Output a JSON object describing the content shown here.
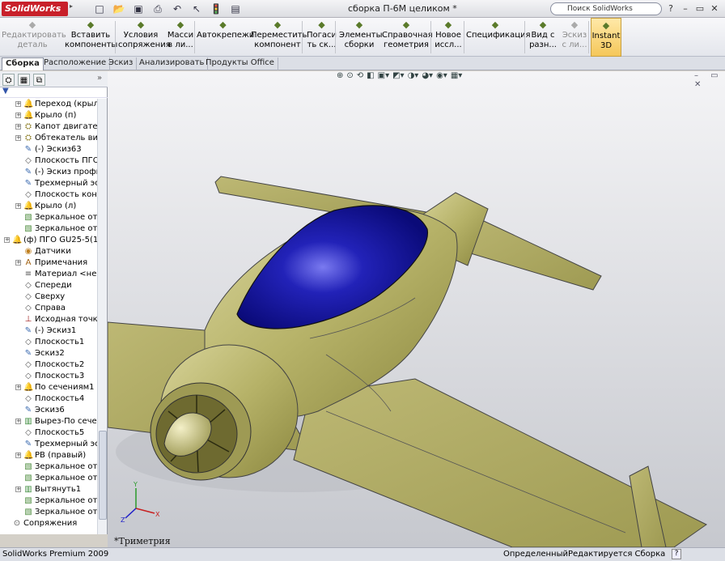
{
  "app": {
    "logo": "SolidWorks",
    "doc_title": "сборка П-6М целиком *",
    "search_placeholder": "Поиск SolidWorks"
  },
  "ribbon": [
    {
      "label": "Редактировать\nдеталь",
      "icon": "edit-part-icon",
      "disabled": true
    },
    {
      "label": "Вставить\nкомпоненты",
      "icon": "insert-components-icon"
    },
    {
      "label": "Условия\nсопряжения",
      "icon": "mate-icon"
    },
    {
      "label": "Масси\nв ли...",
      "icon": "linear-pattern-icon"
    },
    {
      "label": "Автокрепежи",
      "icon": "smart-fasteners-icon"
    },
    {
      "label": "Переместить\nкомпонент",
      "icon": "move-component-icon"
    },
    {
      "label": "Погаси\nть ск...",
      "icon": "hide-icon"
    },
    {
      "label": "Элементы\nсборки",
      "icon": "assembly-features-icon"
    },
    {
      "label": "Справочная\nгеометрия",
      "icon": "reference-geometry-icon"
    },
    {
      "label": "Новое\nиссл...",
      "icon": "new-study-icon"
    },
    {
      "label": "Спецификация",
      "icon": "bom-icon"
    },
    {
      "label": "Вид с\nразн...",
      "icon": "exploded-view-icon"
    },
    {
      "label": "Эскиз\nс ли...",
      "icon": "explode-line-icon",
      "disabled": true
    },
    {
      "label": "Instant\n3D",
      "icon": "instant3d-icon",
      "active": true
    }
  ],
  "tabs": [
    "Сборка",
    "Расположение",
    "Эскиз",
    "Анализировать",
    "Продукты Office"
  ],
  "tree": [
    {
      "label": "Переход (крыло",
      "icon": "part",
      "expand": true,
      "level": 1
    },
    {
      "label": "Крыло (п)",
      "icon": "part",
      "expand": true,
      "level": 1
    },
    {
      "label": "Капот двигателя",
      "icon": "assembly",
      "expand": true,
      "level": 1
    },
    {
      "label": "Обтекатель винт",
      "icon": "assembly",
      "expand": true,
      "level": 1
    },
    {
      "label": "(-) Эскиз63",
      "icon": "sketch",
      "level": 1
    },
    {
      "label": "Плоскость ПГО к",
      "icon": "plane",
      "level": 1
    },
    {
      "label": "(-) Эскиз профил",
      "icon": "sketch",
      "level": 1
    },
    {
      "label": "Трехмерный эск",
      "icon": "sketch3d",
      "level": 1
    },
    {
      "label": "Плоскость конце",
      "icon": "plane",
      "level": 1
    },
    {
      "label": "Крыло (л)",
      "icon": "part",
      "expand": true,
      "level": 1
    },
    {
      "label": "Зеркальное отра",
      "icon": "mirror",
      "level": 1
    },
    {
      "label": "Зеркальное отра",
      "icon": "mirror",
      "level": 1
    },
    {
      "label": "(ф) ПГО GU25-5(11)",
      "icon": "part",
      "expand": true,
      "level": 0
    },
    {
      "label": "Датчики",
      "icon": "sensor",
      "level": 1
    },
    {
      "label": "Примечания",
      "icon": "annotation",
      "expand": true,
      "level": 1
    },
    {
      "label": "Материал <не ук",
      "icon": "material",
      "level": 1
    },
    {
      "label": "Спереди",
      "icon": "plane",
      "level": 1
    },
    {
      "label": "Сверху",
      "icon": "plane",
      "level": 1
    },
    {
      "label": "Справа",
      "icon": "plane",
      "level": 1
    },
    {
      "label": "Исходная точка",
      "icon": "origin",
      "level": 1
    },
    {
      "label": "(-) Эскиз1",
      "icon": "sketch",
      "level": 1
    },
    {
      "label": "Плоскость1",
      "icon": "plane",
      "level": 1
    },
    {
      "label": "Эскиз2",
      "icon": "sketch",
      "level": 1
    },
    {
      "label": "Плоскость2",
      "icon": "plane",
      "level": 1
    },
    {
      "label": "Плоскость3",
      "icon": "plane",
      "level": 1
    },
    {
      "label": "По сечениям1",
      "icon": "part",
      "expand": true,
      "level": 1
    },
    {
      "label": "Плоскость4",
      "icon": "plane",
      "level": 1
    },
    {
      "label": "Эскиз6",
      "icon": "sketch",
      "level": 1
    },
    {
      "label": "Вырез-По сечени",
      "icon": "cut",
      "expand": true,
      "level": 1
    },
    {
      "label": "Плоскость5",
      "icon": "plane",
      "level": 1
    },
    {
      "label": "Трехмерный эск",
      "icon": "sketch3d",
      "level": 1
    },
    {
      "label": "РВ (правый)",
      "icon": "part",
      "expand": true,
      "level": 1
    },
    {
      "label": "Зеркальное отра",
      "icon": "mirror",
      "level": 1
    },
    {
      "label": "Зеркальное отра",
      "icon": "mirror",
      "level": 1
    },
    {
      "label": "Вытянуть1",
      "icon": "extrude",
      "expand": true,
      "level": 1
    },
    {
      "label": "Зеркальное отра",
      "icon": "mirror",
      "level": 1
    },
    {
      "label": "Зеркальное отра",
      "icon": "mirror",
      "level": 1
    },
    {
      "label": "Сопряжения",
      "icon": "mates",
      "level": 0
    }
  ],
  "viewport": {
    "view_name": "*Триметрия"
  },
  "status": {
    "product": "SolidWorks Premium 2009",
    "state": "Определенный",
    "mode": "Редактируется Сборка"
  },
  "colors": {
    "body": "#b8b46a",
    "canopy": "#1c1ca8",
    "bg_top": "#f2f2f4",
    "bg_bottom": "#c8cad0",
    "accent": "#c8202a"
  }
}
